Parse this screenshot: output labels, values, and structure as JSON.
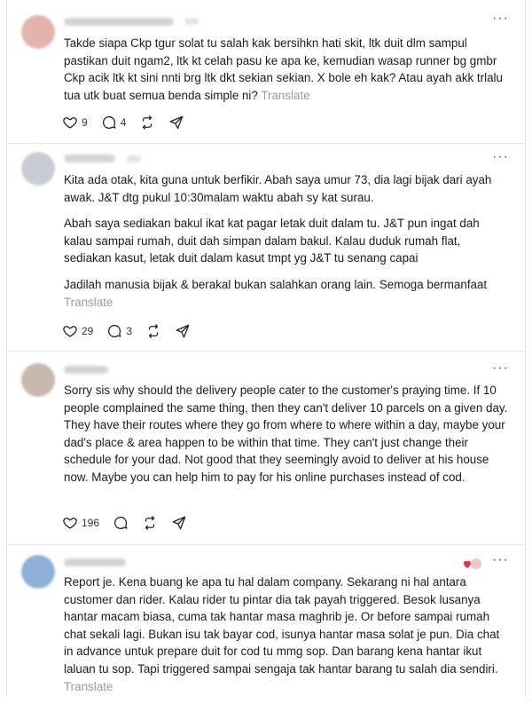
{
  "posts": [
    {
      "avatar_color": "#e2b4ad",
      "paragraphs": [
        "Takde siapa Ckp tgur solat tu salah kak bersihkn hati skit, ltk duit dlm sampul pastikan duit ngam2, ltk kt celah pasu ke apa ke, kemudian wasap runner bg gmbr Ckp acik ltk kt sini nnti brg ltk dkt sekian sekian. X bole eh kak? Atau ayah akk trlalu tua utk buat semua benda simple ni?"
      ],
      "translate": "Translate",
      "likes": "9",
      "replies": "4",
      "reposts": "",
      "shares": ""
    },
    {
      "avatar_color": "#c9ccd4",
      "paragraphs": [
        "Kita ada otak, kita guna untuk berfikir. Abah saya umur 73, dia lagi bijak dari ayah awak. J&T dtg pukul 10:30malam waktu abah sy kat surau.",
        "Abah saya sediakan bakul ikat kat pagar letak duit dalam tu. J&T pun ingat dah kalau sampai rumah, duit dah simpan dalam bakul. Kalau duduk rumah flat, sediakan kasut, letak duit dalam kasut tmpt yg J&T tu senang capai",
        "Jadilah manusia bijak & berakal bukan salahkan orang lain. Semoga bermanfaat"
      ],
      "translate": "Translate",
      "likes": "29",
      "replies": "3",
      "reposts": "",
      "shares": ""
    },
    {
      "avatar_color": "#c8b8ae",
      "paragraphs": [
        "Sorry sis why should the delivery people cater to the customer's praying time. If 10 people complained the same thing, then they can't deliver 10 parcels on a given day. They have their routes where they go from where to where within a day, maybe your dad's place & area happen to be within that time. They can't just change their schedule for your dad. Not good that they seemingly avoid to deliver at his house now. Maybe you can help him to pay for his online purchases instead of cod."
      ],
      "translate": "",
      "likes": "196",
      "replies": "",
      "reposts": "",
      "shares": ""
    },
    {
      "avatar_color": "#8fb0d6",
      "paragraphs": [
        "Report je. Kena buang ke apa tu hal dalam company. Sekarang ni hal antara customer dan rider. Kalau rider tu pintar dia tak payah triggered. Besok lusanya hantar macam biasa, cuma tak hantar masa maghrib je. Or before sampai rumah chat sekali lagi. Bukan isu tak bayar cod, isunya hantar masa solat je pun. Dia chat in advance untuk prepare duit for cod tu mmg sop. Dan barang kena hantar ikut laluan tu sop. Tapi triggered sampai sengaja tak hantar barang tu salah dia sendiri."
      ],
      "translate": "Translate",
      "likes": "",
      "replies": "",
      "reposts": "",
      "shares": ""
    }
  ],
  "more_label": "···",
  "colors": {
    "text": "#1b1b1b",
    "muted": "#9a9a9a",
    "divider": "#e6e6e6",
    "heart": "#e5304a"
  }
}
